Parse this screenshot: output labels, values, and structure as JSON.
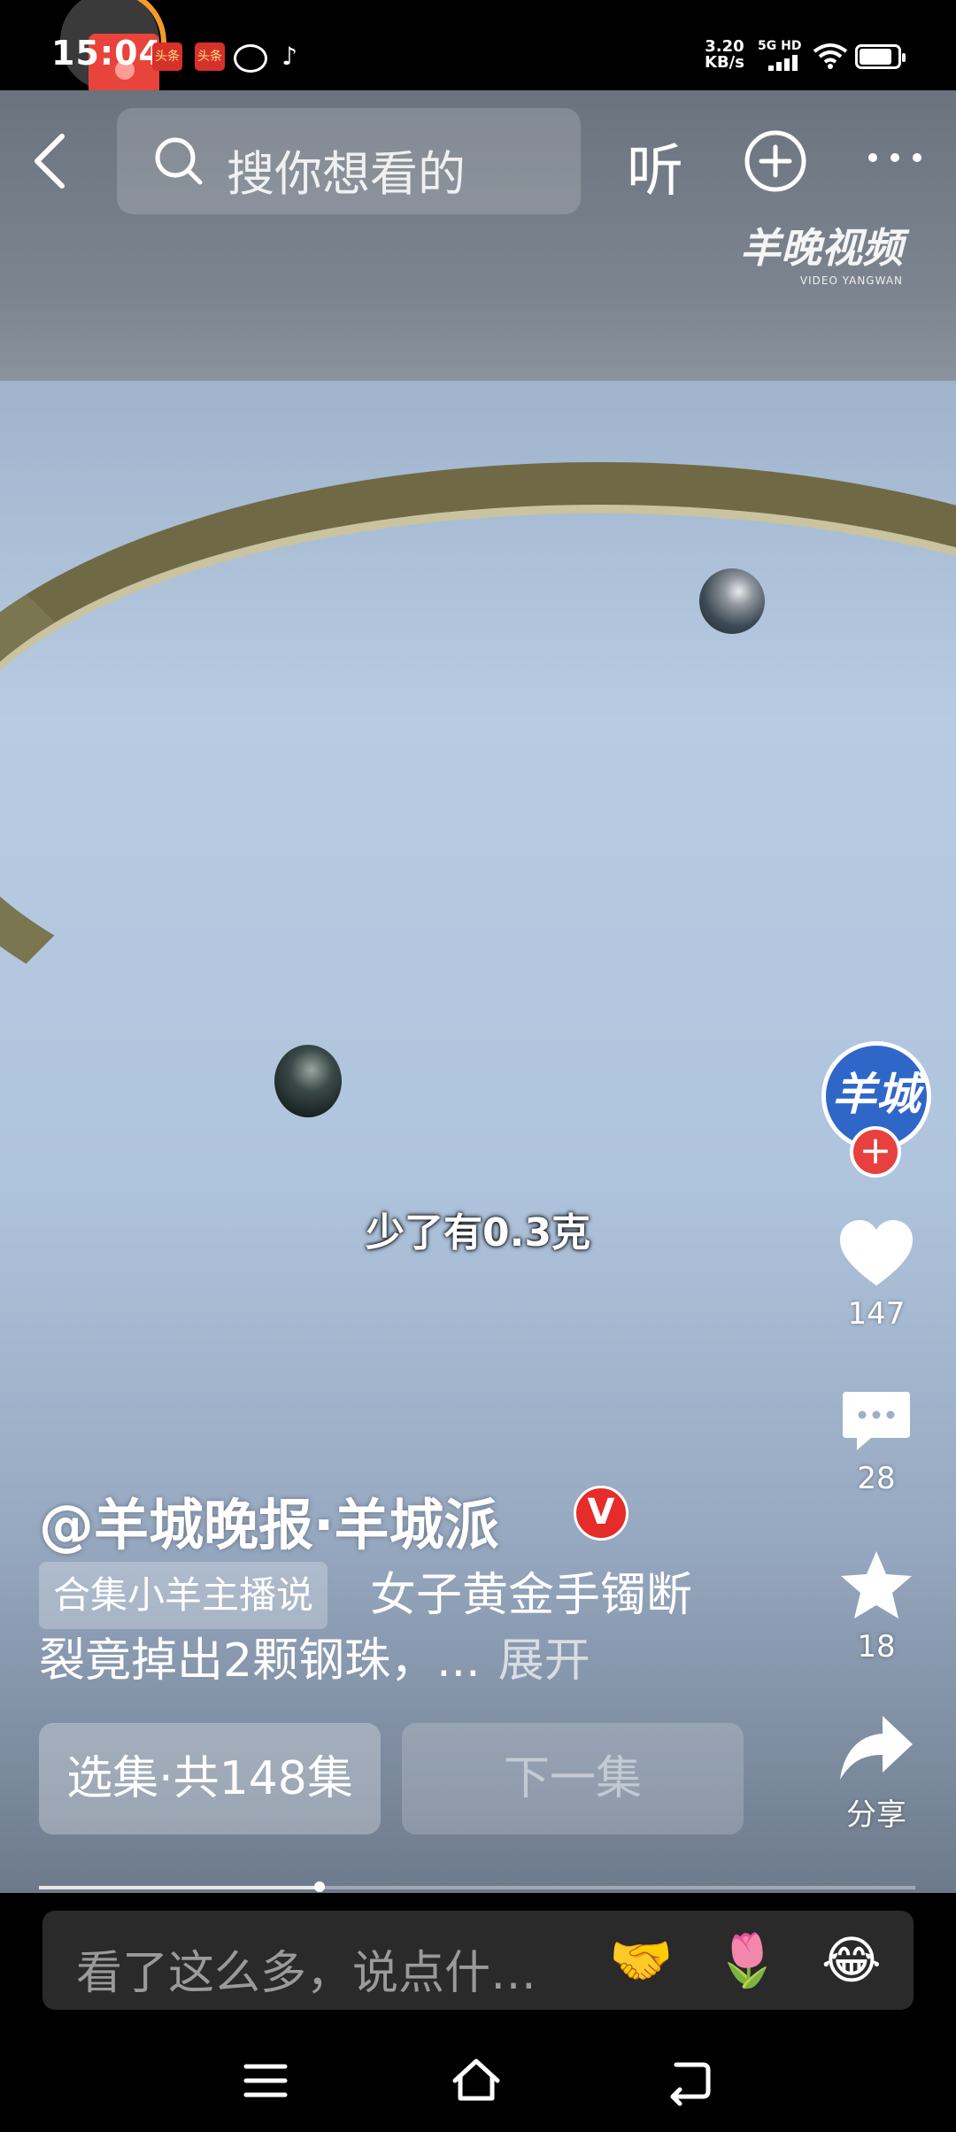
{
  "status_bar": {
    "time": "15:04",
    "net_speed_top": "3.20",
    "net_speed_bottom": "KB/s",
    "network": "5G HD"
  },
  "top_nav": {
    "search_placeholder": "搜你想看的",
    "listen_label": "听",
    "watermark_main": "羊晚视频",
    "watermark_sub": "VIDEO YANGWAN"
  },
  "video": {
    "subtitle": "少了有0.3克"
  },
  "right_rail": {
    "avatar_text": "羊城",
    "likes": "147",
    "comments": "28",
    "favorites": "18",
    "share_label": "分享"
  },
  "caption": {
    "author": "@羊城晚报·羊城派",
    "verified_mark": "V",
    "collection_tag": "合集小羊主播说",
    "desc_line1": "女子黄金手镯断",
    "desc_line2": "裂竟掉出2颗钢珠，...",
    "expand": "展开"
  },
  "actions": {
    "episodes_label": "选集·共148集",
    "next_label": "下一集",
    "progress": 0.32
  },
  "comment_bar": {
    "placeholder": "看了这么多，说点什…",
    "emoji_1": "🤝",
    "emoji_2": "🌷",
    "emoji_3": "😂"
  },
  "icons": [
    "back-icon",
    "search-icon",
    "add-icon",
    "more-icon",
    "heart-icon",
    "comment-icon",
    "star-icon",
    "share-icon",
    "menu-icon",
    "home-icon",
    "back-nav-icon"
  ]
}
